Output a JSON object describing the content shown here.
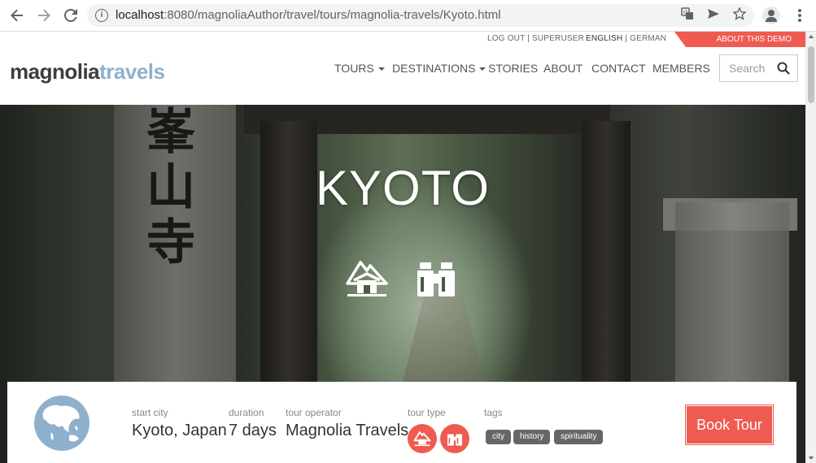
{
  "browser": {
    "url_host": "localhost",
    "url_path": ":8080/magnoliaAuthor/travel/tours/magnolia-travels/Kyoto.html",
    "icons": [
      "back-icon",
      "forward-icon",
      "reload-icon",
      "info-icon",
      "translate-icon",
      "send-icon",
      "star-icon",
      "profile-icon",
      "menu-icon"
    ]
  },
  "topbar": {
    "logout": "LOG OUT",
    "separator": "|",
    "user": "SUPERUSER",
    "lang_active": "ENGLISH",
    "lang_other": "GERMAN",
    "demo_ribbon": "ABOUT THIS DEMO"
  },
  "logo": {
    "part1": "magnolia",
    "part2": "travels"
  },
  "nav": {
    "tours": "TOURS",
    "destinations": "DESTINATIONS",
    "stories": "STORIES",
    "about": "ABOUT",
    "contact": "CONTACT",
    "members": "MEMBERS"
  },
  "search": {
    "placeholder": "Search"
  },
  "hero": {
    "title": "KYOTO",
    "kanji": "峯山寺",
    "icons": [
      "mountain-house-icon",
      "binoculars-icon"
    ]
  },
  "tour": {
    "start_city_label": "start city",
    "start_city": "Kyoto, Japan",
    "duration_label": "duration",
    "duration": "7 days",
    "operator_label": "tour operator",
    "operator": "Magnolia Travels",
    "type_label": "tour type",
    "tags_label": "tags",
    "tags": [
      "city",
      "history",
      "spirituality"
    ],
    "book_label": "Book Tour"
  },
  "colors": {
    "accent": "#ef5b50",
    "logo_blue": "#8fb0cd",
    "tag_bg": "#666666"
  }
}
